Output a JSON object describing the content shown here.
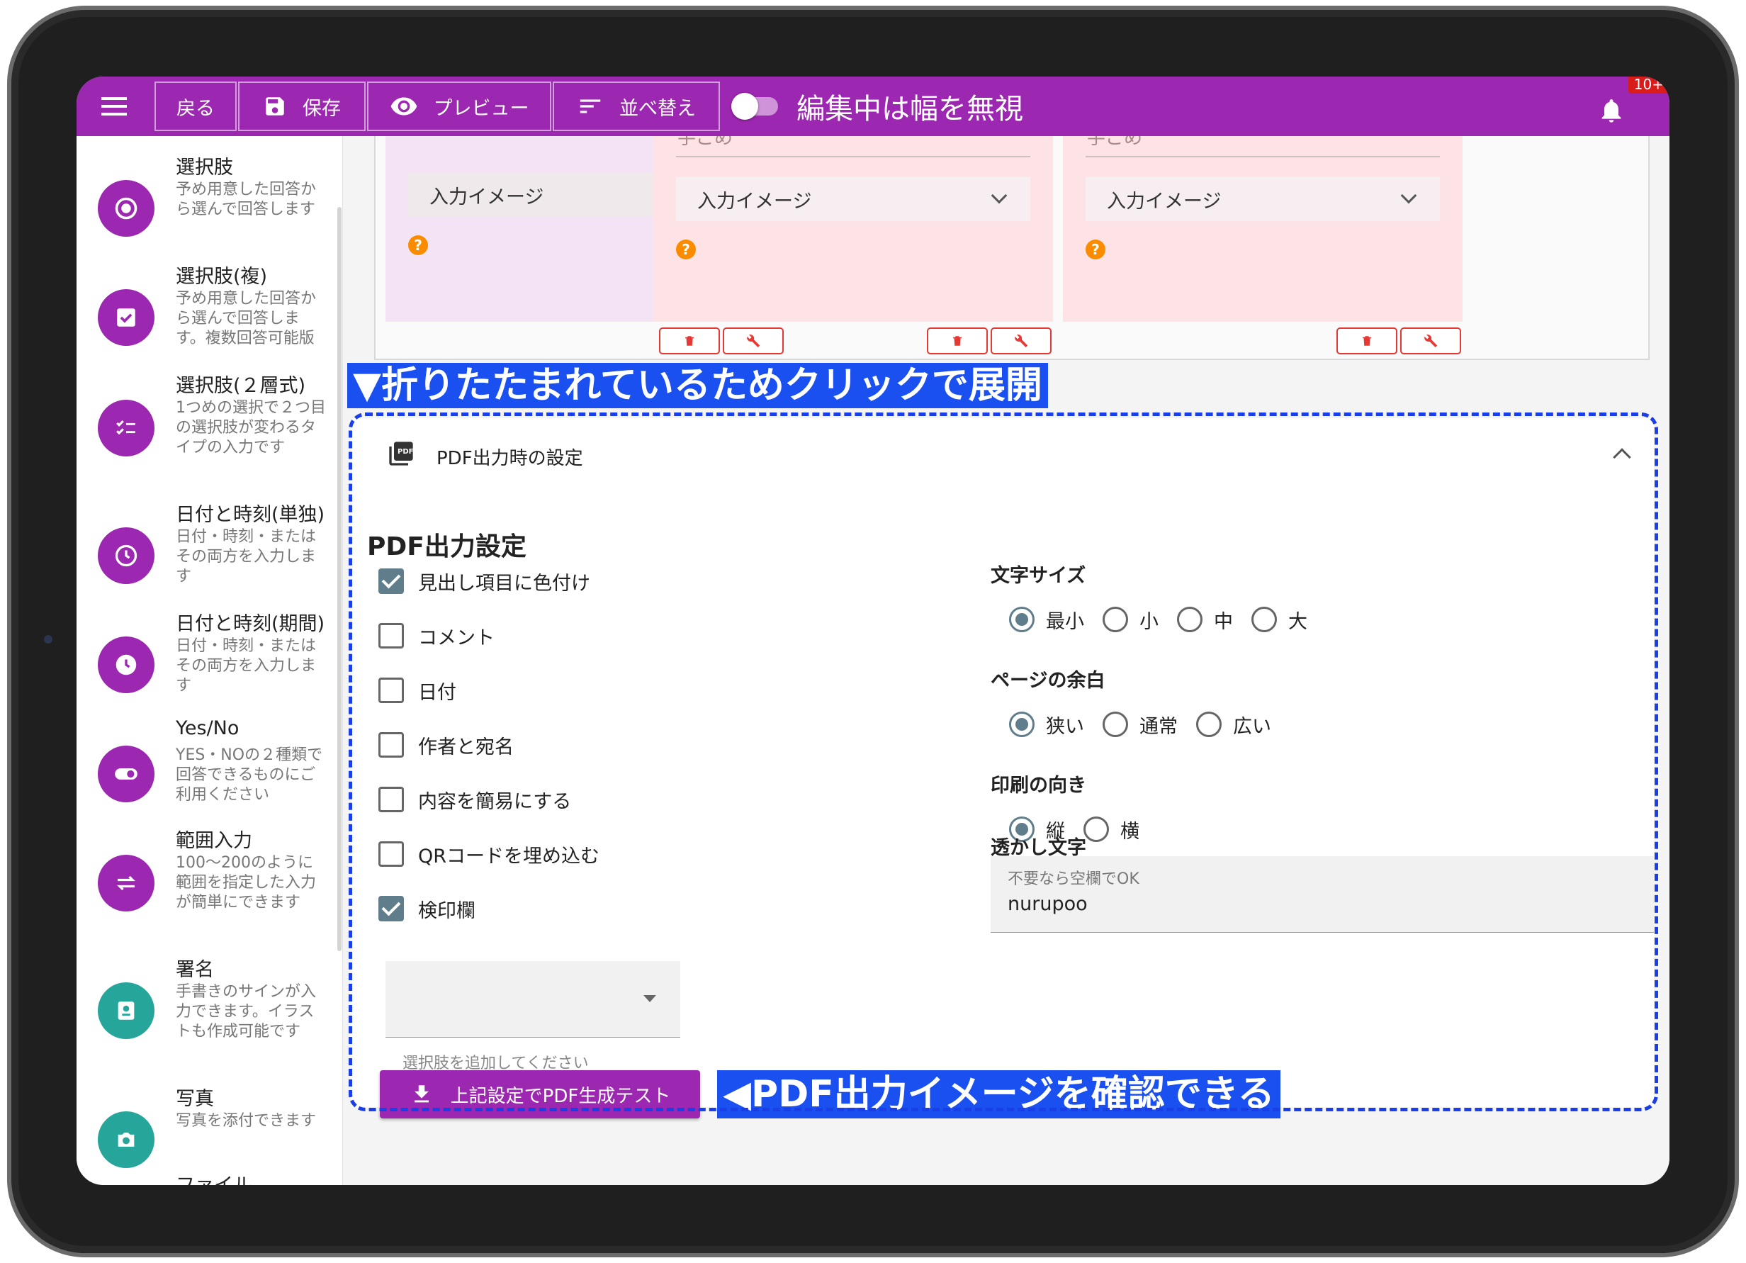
{
  "topbar": {
    "back": "戻る",
    "save": "保存",
    "preview": "プレビュー",
    "sort": "並べ替え",
    "toggle_label": "編集中は幅を無視",
    "badge": "10+"
  },
  "sidebar": {
    "items": [
      {
        "title": "選択肢",
        "desc": "予め用意した回答から選んで回答します",
        "icon": "radio-icon"
      },
      {
        "title": "選択肢(複)",
        "desc": "予め用意した回答から選んで回答します。複数回答可能版",
        "icon": "checkbox-icon"
      },
      {
        "title": "選択肢(２層式)",
        "desc": "1つめの選択で２つ目の選択肢が変わるタイプの入力です",
        "icon": "checklist-icon"
      },
      {
        "title": "日付と時刻(単独)",
        "desc": "日付・時刻・またはその両方を入力します",
        "icon": "clock-icon"
      },
      {
        "title": "日付と時刻(期間)",
        "desc": "日付・時刻・またはその両方を入力します",
        "icon": "clock-filled-icon"
      },
      {
        "title": "Yes/No",
        "desc": "YES・NOの２種類で回答できるものにご利用ください",
        "icon": "toggle-icon"
      },
      {
        "title": "範囲入力",
        "desc": "100〜200のように範囲を指定した入力が簡単にできます",
        "icon": "swap-icon"
      },
      {
        "title": "署名",
        "desc": "手書きのサインが入力できます。イラストも作成可能です",
        "icon": "signature-icon"
      },
      {
        "title": "写真",
        "desc": "写真を添付できます",
        "icon": "camera-icon"
      },
      {
        "title": "ファイル",
        "desc": "",
        "icon": "file-icon"
      }
    ]
  },
  "cards": [
    {
      "dropdown": "入力イメージ"
    },
    {
      "dropdown": "入力イメージ"
    },
    {
      "dropdown": "入力イメージ"
    }
  ],
  "card_cutoff_text": "手ごめ",
  "note_expand": "▼折りたたまれているためクリックで展開",
  "panel": {
    "header_title": "PDF出力時の設定",
    "section_title": "PDF出力設定",
    "checkboxes": [
      {
        "label": "見出し項目に色付け",
        "checked": true
      },
      {
        "label": "コメント",
        "checked": false
      },
      {
        "label": "日付",
        "checked": false
      },
      {
        "label": "作者と宛名",
        "checked": false
      },
      {
        "label": "内容を簡易にする",
        "checked": false
      },
      {
        "label": "QRコードを埋め込む",
        "checked": false
      },
      {
        "label": "検印欄",
        "checked": true
      }
    ],
    "select_helper": "選択肢を追加してください",
    "font_size": {
      "title": "文字サイズ",
      "options": [
        "最小",
        "小",
        "中",
        "大"
      ],
      "selected": "最小"
    },
    "margin": {
      "title": "ページの余白",
      "options": [
        "狭い",
        "通常",
        "広い"
      ],
      "selected": "狭い"
    },
    "orientation": {
      "title": "印刷の向き",
      "options": [
        "縦",
        "横"
      ],
      "selected": "縦"
    },
    "watermark": {
      "title": "透かし文字",
      "placeholder": "不要なら空欄でOK",
      "value": "nurupoo"
    },
    "generate_button": "上記設定でPDF生成テスト"
  },
  "note_preview": "◀PDF出力イメージを確認できる",
  "colors": {
    "primary": "#9c27b0",
    "teal": "#26a69a",
    "annotation_blue": "#1a4ff0",
    "danger": "#e53935",
    "help": "#fb8c00"
  }
}
